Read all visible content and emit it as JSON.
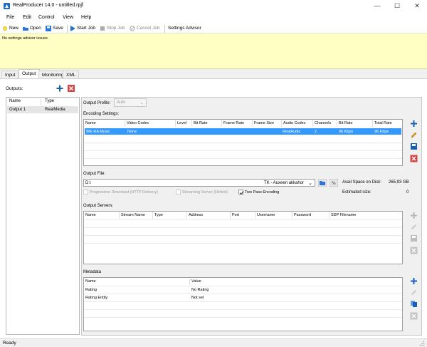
{
  "window": {
    "title": "RealProducer 14.0 - untitled.rpjf",
    "minimize": "—",
    "maximize": "☐",
    "close": "✕"
  },
  "menu": [
    "File",
    "Edit",
    "Control",
    "View",
    "Help"
  ],
  "toolbar": {
    "new": "New",
    "open": "Open",
    "save": "Save",
    "start_job": "Start Job",
    "stop_job": "Stop Job",
    "cancel_job": "Cancel Job",
    "settings_advisor": "Settings Advisor"
  },
  "advisor": {
    "message": "No settings advisor issues"
  },
  "tabs": [
    "Input",
    "Output",
    "Monitoring",
    "XML"
  ],
  "outputs": {
    "label": "Outputs:",
    "columns": [
      "Name",
      "Type"
    ],
    "rows": [
      {
        "name": "Output 1",
        "type": "RealMedia"
      }
    ]
  },
  "output_profile": {
    "label": "Output Profile:",
    "value": "Auto"
  },
  "encoding": {
    "label": "Encoding Settings:",
    "columns": [
      "Name",
      "Video Codec",
      "Level",
      "Bit Rate",
      "Frame Rate",
      "Frame Size",
      "Audio Codec",
      "Channels",
      "Bit Rate",
      "Total Rate"
    ],
    "rows": [
      [
        "96k RA Music",
        "None",
        "",
        "",
        "",
        "",
        "RealAudio",
        "2",
        "96 Kbps",
        "96 Kbps"
      ]
    ]
  },
  "output_file": {
    "label": "Output File:",
    "path": "D:\\",
    "volume": "TK - Auxeen akkahor",
    "avail_label": "Avail Space on Disk:",
    "avail_value": "265,93 GB",
    "estimated_label": "Estimated size:",
    "estimated_value": "0",
    "progressive": "Progressive Download (HTTP Delivery)",
    "streaming": "Streaming Server (Hinted)",
    "two_pass": "Two Pass Encoding",
    "two_pass_checked": true
  },
  "output_servers": {
    "label": "Output Servers:",
    "columns": [
      "Name",
      "Stream Name",
      "Type",
      "Address",
      "Port",
      "Username",
      "Password",
      "SDP Filename"
    ]
  },
  "metadata": {
    "label": "Metadata",
    "columns": [
      "Name",
      "Value"
    ],
    "rows": [
      {
        "name": "Rating",
        "value": "No Rating"
      },
      {
        "name": "Rating Entity",
        "value": "Not set"
      }
    ]
  },
  "status": {
    "text": "Ready"
  },
  "colors": {
    "selection": "#3399ff",
    "advisor_bg": "#ffffc4",
    "add_blue": "#1a5fb4",
    "delete_red": "#c0392b"
  }
}
